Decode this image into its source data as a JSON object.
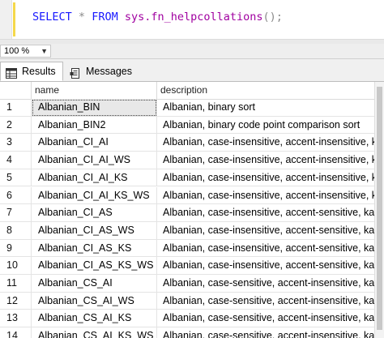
{
  "editor": {
    "kw_select": "SELECT",
    "star": "*",
    "kw_from": "FROM",
    "fn_name": "sys.fn_helpcollations",
    "tail": "();"
  },
  "zoom": {
    "value": "100 %"
  },
  "tabs": {
    "results": "Results",
    "messages": "Messages"
  },
  "grid": {
    "columns": [
      "name",
      "description"
    ],
    "rows": [
      {
        "num": "1",
        "name": "Albanian_BIN",
        "description": "Albanian, binary sort"
      },
      {
        "num": "2",
        "name": "Albanian_BIN2",
        "description": "Albanian, binary code point comparison sort"
      },
      {
        "num": "3",
        "name": "Albanian_CI_AI",
        "description": "Albanian, case-insensitive, accent-insensitive, k..."
      },
      {
        "num": "4",
        "name": "Albanian_CI_AI_WS",
        "description": "Albanian, case-insensitive, accent-insensitive, k..."
      },
      {
        "num": "5",
        "name": "Albanian_CI_AI_KS",
        "description": "Albanian, case-insensitive, accent-insensitive, k..."
      },
      {
        "num": "6",
        "name": "Albanian_CI_AI_KS_WS",
        "description": "Albanian, case-insensitive, accent-insensitive, k..."
      },
      {
        "num": "7",
        "name": "Albanian_CI_AS",
        "description": "Albanian, case-insensitive, accent-sensitive, ka..."
      },
      {
        "num": "8",
        "name": "Albanian_CI_AS_WS",
        "description": "Albanian, case-insensitive, accent-sensitive, ka..."
      },
      {
        "num": "9",
        "name": "Albanian_CI_AS_KS",
        "description": "Albanian, case-insensitive, accent-sensitive, ka..."
      },
      {
        "num": "10",
        "name": "Albanian_CI_AS_KS_WS",
        "description": "Albanian, case-insensitive, accent-sensitive, ka..."
      },
      {
        "num": "11",
        "name": "Albanian_CS_AI",
        "description": "Albanian, case-sensitive, accent-insensitive, ka..."
      },
      {
        "num": "12",
        "name": "Albanian_CS_AI_WS",
        "description": "Albanian, case-sensitive, accent-insensitive, ka..."
      },
      {
        "num": "13",
        "name": "Albanian_CS_AI_KS",
        "description": "Albanian, case-sensitive, accent-insensitive, ka..."
      },
      {
        "num": "14",
        "name": "Albanian_CS_AI_KS_WS",
        "description": "Albanian, case-sensitive, accent-insensitive, ka..."
      }
    ]
  },
  "icons": {
    "results_tab": "grid-icon",
    "messages_tab": "messages-icon",
    "zoom_dropdown": "chevron-down-icon"
  },
  "colors": {
    "keyword": "#1818ff",
    "function": "#a000a0",
    "operator": "#8a8a8a",
    "editor_marker": "#f5d84b"
  }
}
